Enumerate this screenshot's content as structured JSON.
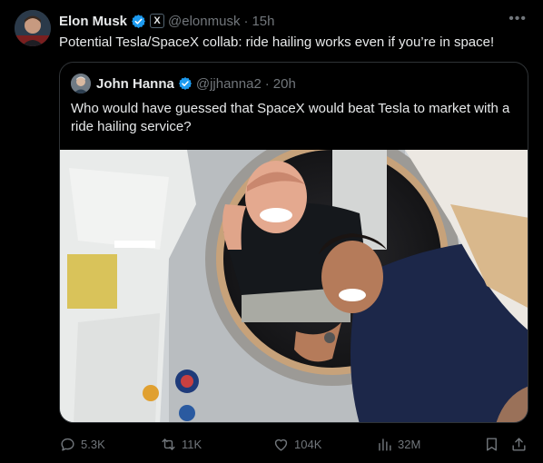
{
  "tweet": {
    "author_name": "Elon Musk",
    "author_handle": "@elonmusk",
    "separator": "·",
    "time": "15h",
    "affiliate_badge": "X",
    "text": "Potential Tesla/SpaceX collab: ride hailing works even if you’re in space!",
    "more_icon": "more-horizontal-icon",
    "verified_color": "#1d9bf0"
  },
  "quote": {
    "author_name": "John Hanna",
    "author_handle": "@jjhanna2",
    "separator": "·",
    "time": "20h",
    "text": "Who would have guessed that SpaceX would beat Tesla to market with a ride hailing service?"
  },
  "actions": {
    "replies": "5.3K",
    "reposts": "11K",
    "likes": "104K",
    "views": "32M",
    "reply_icon": "reply-icon",
    "repost_icon": "repost-icon",
    "like_icon": "heart-icon",
    "views_icon": "analytics-icon",
    "bookmark_icon": "bookmark-icon",
    "share_icon": "share-icon"
  },
  "colors": {
    "background": "#000000",
    "text": "#e7e9ea",
    "muted": "#71767b",
    "border": "#2f3336",
    "accent": "#1d9bf0"
  }
}
